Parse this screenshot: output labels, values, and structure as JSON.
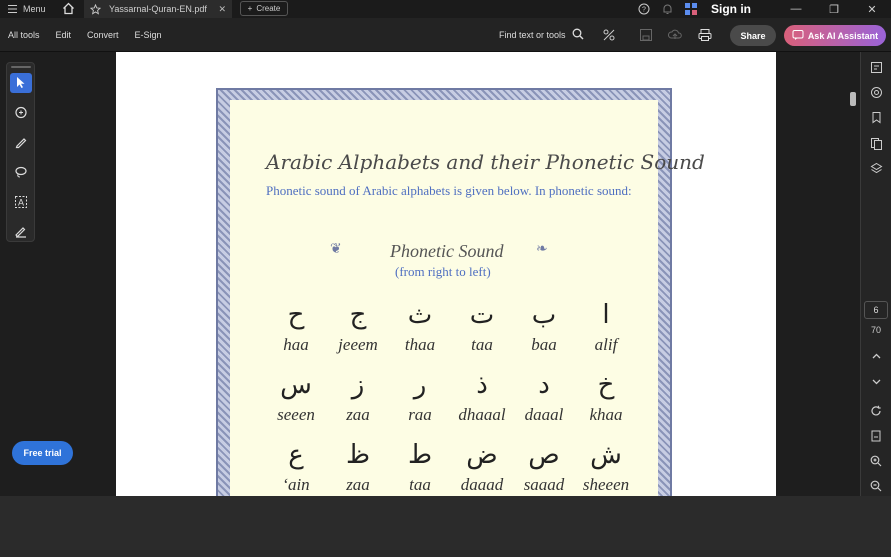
{
  "titlebar": {
    "menu_label": "Menu",
    "tab_title": "Yassarnal-Quran-EN.pdf",
    "create_label": "Create",
    "sign_in": "Sign in"
  },
  "toolbar": {
    "all_tools": "All tools",
    "edit": "Edit",
    "convert": "Convert",
    "esign": "E-Sign",
    "find": "Find text or tools",
    "share": "Share",
    "ai_assistant": "Ask AI Assistant"
  },
  "left_panel": {
    "free_trial": "Free trial"
  },
  "document": {
    "title": "Arabic Alphabets and their Phonetic Sound",
    "description": "Phonetic sound of Arabic alphabets is given below. In phonetic sound:",
    "section_title": "Phonetic Sound",
    "section_subtitle": "(from right to left)",
    "letters": [
      {
        "ar": "ح",
        "ph": "haa"
      },
      {
        "ar": "ج",
        "ph": "jeeem"
      },
      {
        "ar": "ث",
        "ph": "thaa"
      },
      {
        "ar": "ت",
        "ph": "taa"
      },
      {
        "ar": "ب",
        "ph": "baa"
      },
      {
        "ar": "ا",
        "ph": "alif"
      },
      {
        "ar": "س",
        "ph": "seeen"
      },
      {
        "ar": "ز",
        "ph": "zaa"
      },
      {
        "ar": "ر",
        "ph": "raa"
      },
      {
        "ar": "ذ",
        "ph": "dhaaal"
      },
      {
        "ar": "د",
        "ph": "daaal"
      },
      {
        "ar": "خ",
        "ph": "khaa"
      },
      {
        "ar": "ع",
        "ph": "‘ain"
      },
      {
        "ar": "ظ",
        "ph": "zaa"
      },
      {
        "ar": "ط",
        "ph": "taa"
      },
      {
        "ar": "ض",
        "ph": "daaad"
      },
      {
        "ar": "ص",
        "ph": "saaad"
      },
      {
        "ar": "ش",
        "ph": "sheeen"
      }
    ]
  },
  "right_panel": {
    "current_page": "6",
    "total_pages": "70"
  },
  "colors": {
    "accent_blue": "#3a6fd8",
    "paper": "#fdfde4",
    "doc_blue_text": "#4f6fc1"
  }
}
